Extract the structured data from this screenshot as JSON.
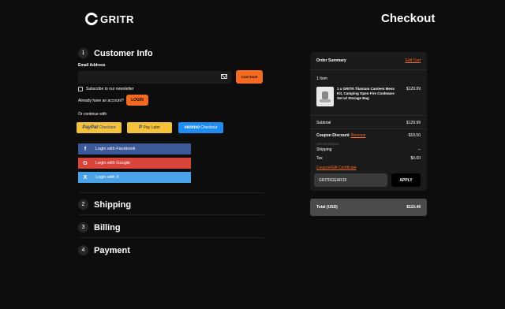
{
  "brand": {
    "name": "GRITR"
  },
  "page": {
    "title": "Checkout"
  },
  "customer_info": {
    "step": "1",
    "title": "Customer Info",
    "email_label": "Email Address",
    "email_value": "",
    "email_placeholder": "",
    "continue_label": "CONTINUE",
    "newsletter_label": "Subscribe to our newsletter",
    "account_prompt": "Already have an account?",
    "login_label": "LOGIN",
    "or_continue": "Or continue with",
    "paypal": {
      "brand": "PayPal",
      "label": "Checkout"
    },
    "paylater": {
      "brand": "P",
      "label": "Pay Later"
    },
    "venmo": {
      "brand": "venmo",
      "label": "Checkout"
    },
    "social": {
      "facebook": {
        "icon": "f",
        "label": "Login with Facebook"
      },
      "google": {
        "icon": "G",
        "label": "Login with Google"
      },
      "x": {
        "icon": "X",
        "label": "Login with X"
      }
    }
  },
  "steps": [
    {
      "num": "2",
      "title": "Shipping"
    },
    {
      "num": "3",
      "title": "Billing"
    },
    {
      "num": "4",
      "title": "Payment"
    }
  ],
  "summary": {
    "title": "Order Summary",
    "edit_label": "Edit Cart",
    "item_count": "1 Item",
    "product": {
      "name": "1 x GRITR Titanium Canteen Mess Kit, Camping Open Fire Cookware Set w/ Storage Bag",
      "price": "$129.99"
    },
    "subtotal_label": "Subtotal",
    "subtotal_value": "$129.99",
    "coupon_label": "Coupon Discount",
    "remove_label": "Remove",
    "coupon_value": "-$19.50",
    "coupon_code": "GRITRGEAR15",
    "shipping_label": "Shipping",
    "shipping_value": "--",
    "tax_label": "Tax",
    "tax_value": "$0.00",
    "coupon_link": "Coupon/Gift Certificate",
    "coupon_input_value": "GRITRGEAR15",
    "apply_label": "APPLY",
    "total_label": "Total (USD)",
    "total_value": "$110.49"
  },
  "colors": {
    "accent": "#f26a22",
    "background": "#0d0d0d",
    "panel": "#1a1a1a"
  },
  "icons": {
    "email": "mail-icon"
  }
}
